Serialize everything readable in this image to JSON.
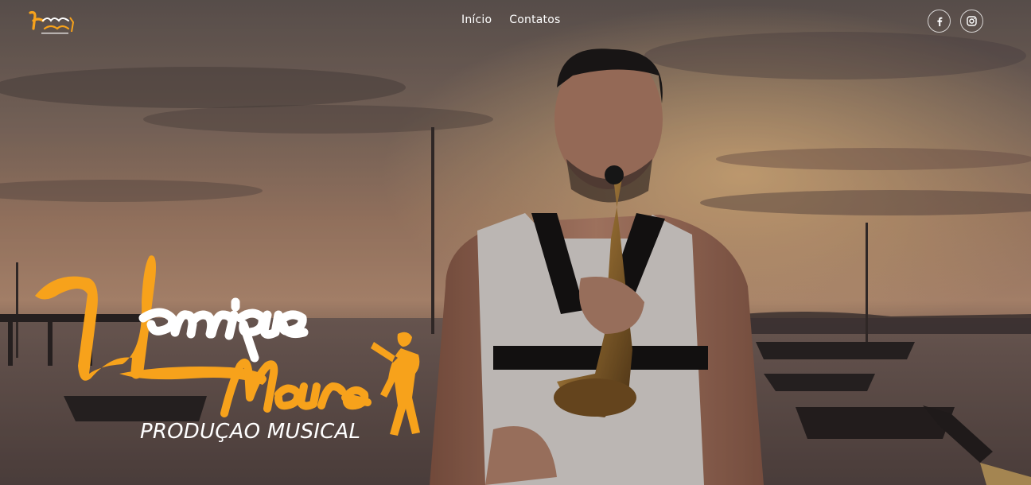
{
  "header": {
    "logo_alt": "Henrique Moura",
    "nav": [
      {
        "label": "Início"
      },
      {
        "label": "Contatos"
      }
    ],
    "social": [
      {
        "icon": "facebook-icon"
      },
      {
        "icon": "instagram-icon"
      }
    ]
  },
  "hero": {
    "brand_name_line1": "Henrique",
    "brand_name_line2": "Moura",
    "brand_tagline": "PRODUÇAO MUSICAL",
    "colors": {
      "accent": "#f7a21b",
      "text": "#ffffff",
      "overlay": "#000000"
    }
  }
}
